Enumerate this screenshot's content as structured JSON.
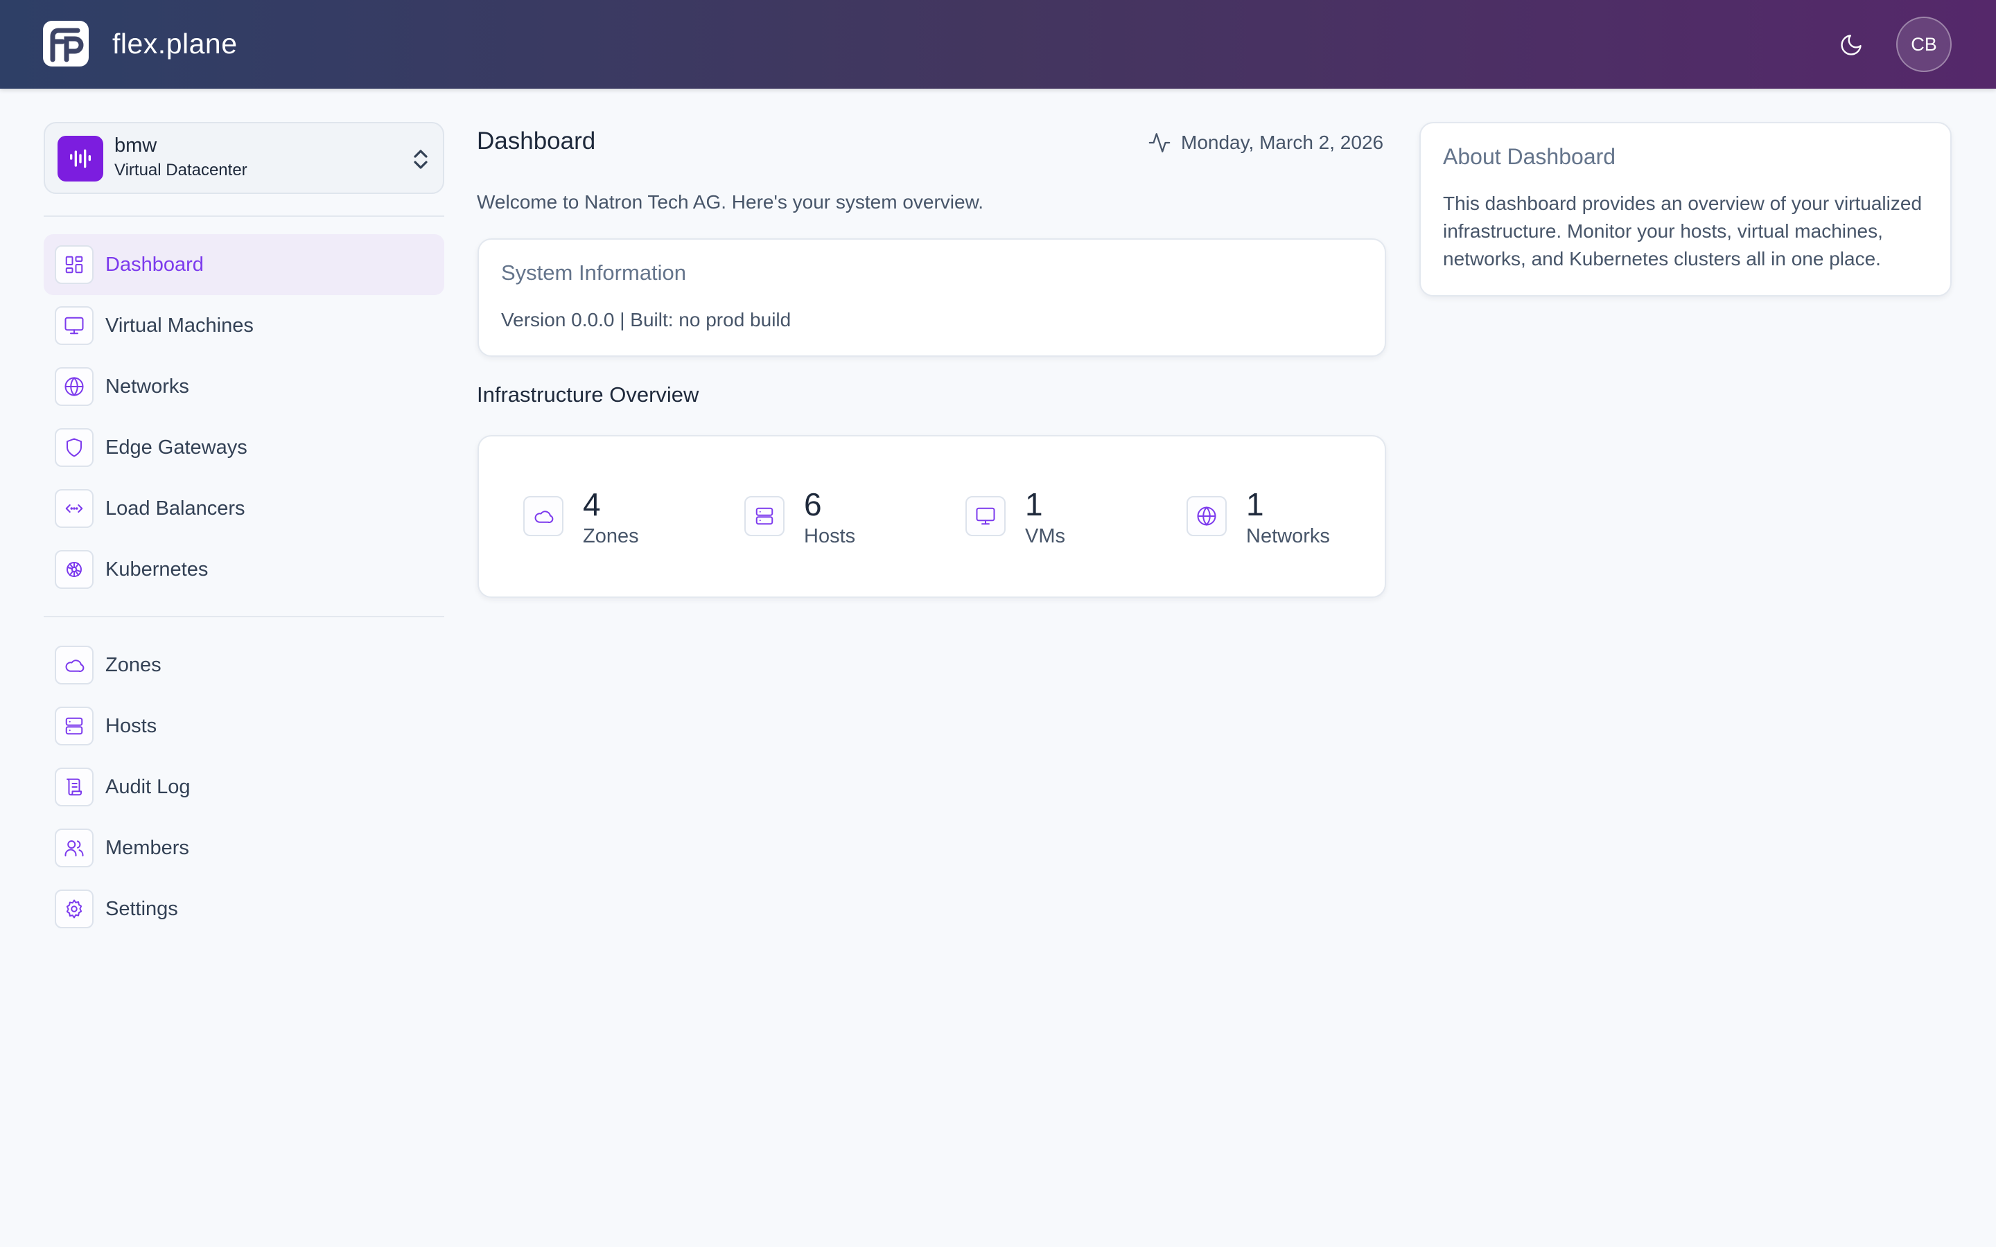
{
  "app": {
    "brand": "flex.plane",
    "user_initials": "CB"
  },
  "datacenter": {
    "name": "bmw",
    "type": "Virtual Datacenter"
  },
  "sidebar": {
    "primary": [
      {
        "label": "Dashboard",
        "icon": "dashboard-icon",
        "active": true
      },
      {
        "label": "Virtual Machines",
        "icon": "monitor-icon"
      },
      {
        "label": "Networks",
        "icon": "globe-icon"
      },
      {
        "label": "Edge Gateways",
        "icon": "shield-icon"
      },
      {
        "label": "Load Balancers",
        "icon": "code-icon"
      },
      {
        "label": "Kubernetes",
        "icon": "kubernetes-icon"
      }
    ],
    "secondary": [
      {
        "label": "Zones",
        "icon": "cloud-icon"
      },
      {
        "label": "Hosts",
        "icon": "server-icon"
      },
      {
        "label": "Audit Log",
        "icon": "scroll-icon"
      },
      {
        "label": "Members",
        "icon": "users-icon"
      },
      {
        "label": "Settings",
        "icon": "gear-icon"
      }
    ]
  },
  "main": {
    "title": "Dashboard",
    "date": "Monday, March 2, 2026",
    "welcome": "Welcome to Natron Tech AG. Here's your system overview.",
    "system_info": {
      "title": "System Information",
      "version": "Version 0.0.0 | Built: no prod build"
    },
    "overview_title": "Infrastructure Overview",
    "stats": [
      {
        "value": "4",
        "label": "Zones",
        "icon": "cloud-icon"
      },
      {
        "value": "6",
        "label": "Hosts",
        "icon": "server-icon"
      },
      {
        "value": "1",
        "label": "VMs",
        "icon": "monitor-icon"
      },
      {
        "value": "1",
        "label": "Networks",
        "icon": "globe-icon"
      }
    ]
  },
  "about": {
    "title": "About Dashboard",
    "text": "This dashboard provides an overview of your virtualized infrastructure. Monitor your hosts, virtual machines, networks, and Kubernetes clusters all in one place."
  },
  "colors": {
    "accent": "#7c3aed",
    "header_start": "#2e3f66",
    "header_end": "#55286a",
    "datacenter_icon": "#7c1ddf"
  }
}
